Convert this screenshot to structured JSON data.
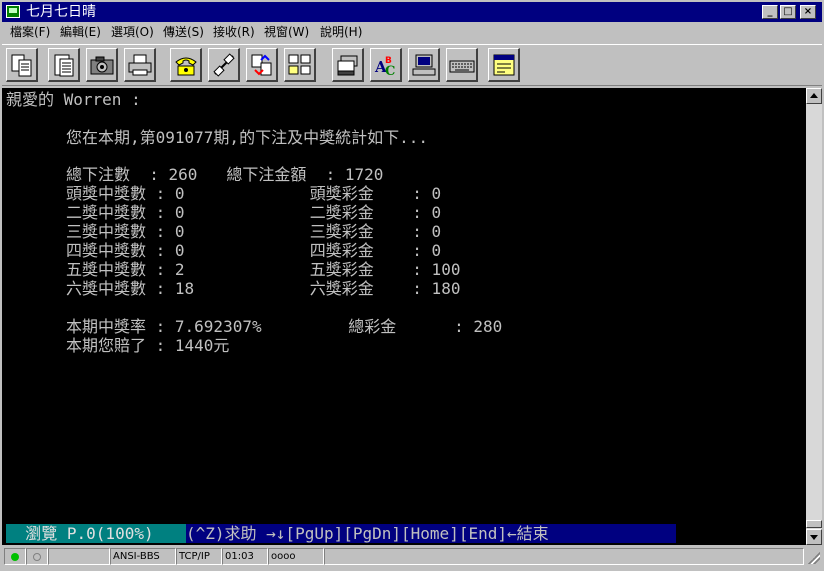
{
  "window": {
    "title": "七月七日晴",
    "buttons": {
      "minimize": "_",
      "maximize": "□",
      "close": "×"
    }
  },
  "menu": [
    "檔案(F)",
    "編輯(E)",
    "選項(O)",
    "傳送(S)",
    "接收(R)",
    "視窗(W)",
    "說明(H)"
  ],
  "toolbar": {
    "icons": [
      "copy-icon",
      "paste-icon",
      "camera-icon",
      "print-icon",
      "phone-dial-icon",
      "disconnect-icon",
      "transfer-icon",
      "folder-icon",
      "stack-icon",
      "abc-spell-icon",
      "computer-icon",
      "keyboard-icon",
      "note-icon"
    ]
  },
  "terminal": {
    "greeting": "親愛的 Worren :",
    "intro": "您在本期,第091077期,的下注及中獎統計如下...",
    "totals": "總下注數  : 260   總下注金額  : 1720",
    "rows": [
      "頭獎中獎數 : 0             頭獎彩金    : 0",
      "二獎中獎數 : 0             二獎彩金    : 0",
      "三獎中獎數 : 0             三獎彩金    : 0",
      "四獎中獎數 : 0             四獎彩金    : 0",
      "五獎中獎數 : 2             五獎彩金    : 100",
      "六獎中獎數 : 18            六獎彩金    : 180"
    ],
    "rate": "本期中獎率 : 7.692307%         總彩金      : 280",
    "loss": "本期您賠了 : 1440元",
    "status_left": "  瀏覽 P.0(100%) ",
    "status_right": "(^Z)求助 →↓[PgUp][PgDn][Home][End]←結束"
  },
  "statusbar": {
    "mode": "ANSI-BBS",
    "protocol": "TCP/IP",
    "time": "01:03",
    "indicators": "oooo"
  },
  "colors": {
    "titlebar": "#000080",
    "terminal_bg": "#000000",
    "terminal_fg": "#c0c0c0",
    "status_left_bg": "#008080",
    "status_right_bg": "#000080"
  }
}
